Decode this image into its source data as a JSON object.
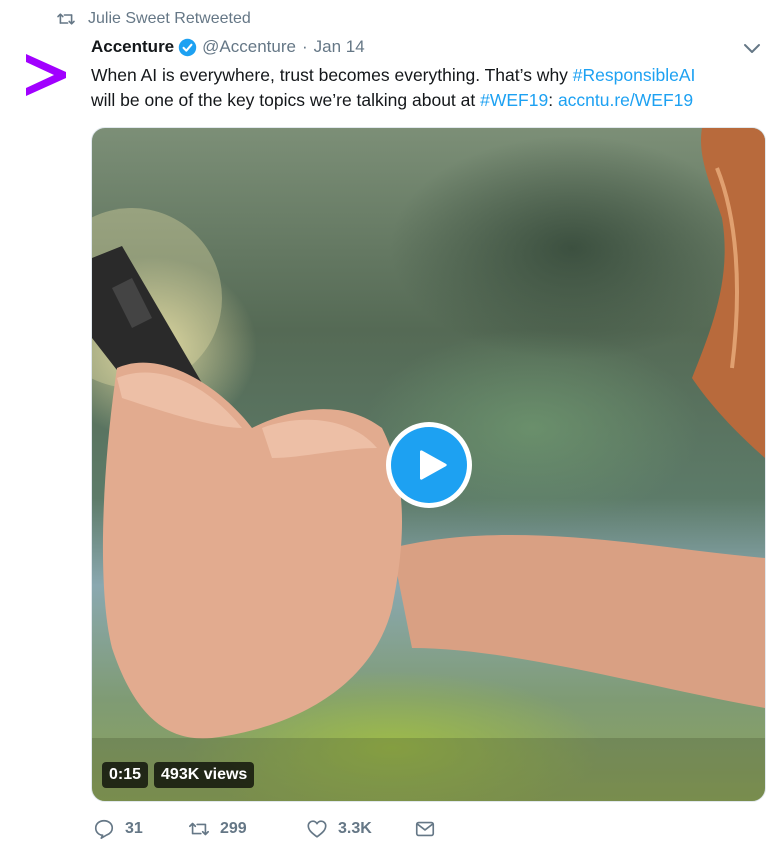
{
  "retweet_context": {
    "label": "Julie Sweet Retweeted",
    "icon": "retweet-icon"
  },
  "author": {
    "name": "Accenture",
    "verified": true,
    "handle": "@Accenture",
    "separator": "·",
    "date": "Jan 14",
    "avatar_icon": "accenture-logo",
    "brand_color": "#a100ff"
  },
  "tweet": {
    "line1_text": "When AI is everywhere, trust becomes everything. That’s why ",
    "line1_hashtag": "#ResponsibleAI",
    "line2_text": "will be one of the key topics we’re talking about at ",
    "line2_hashtag": "#WEF19",
    "line2_colon": ": ",
    "link": "accntu.re/WEF19"
  },
  "media": {
    "type": "video",
    "duration": "0:15",
    "views": "493K views",
    "play_icon": "play-icon"
  },
  "actions": {
    "replies": "31",
    "retweets": "299",
    "likes": "3.3K",
    "reply_icon": "reply-icon",
    "retweet_icon": "retweet-icon",
    "like_icon": "heart-icon",
    "dm_icon": "envelope-icon"
  },
  "colors": {
    "link": "#1da1f2",
    "secondary_text": "#657786"
  }
}
